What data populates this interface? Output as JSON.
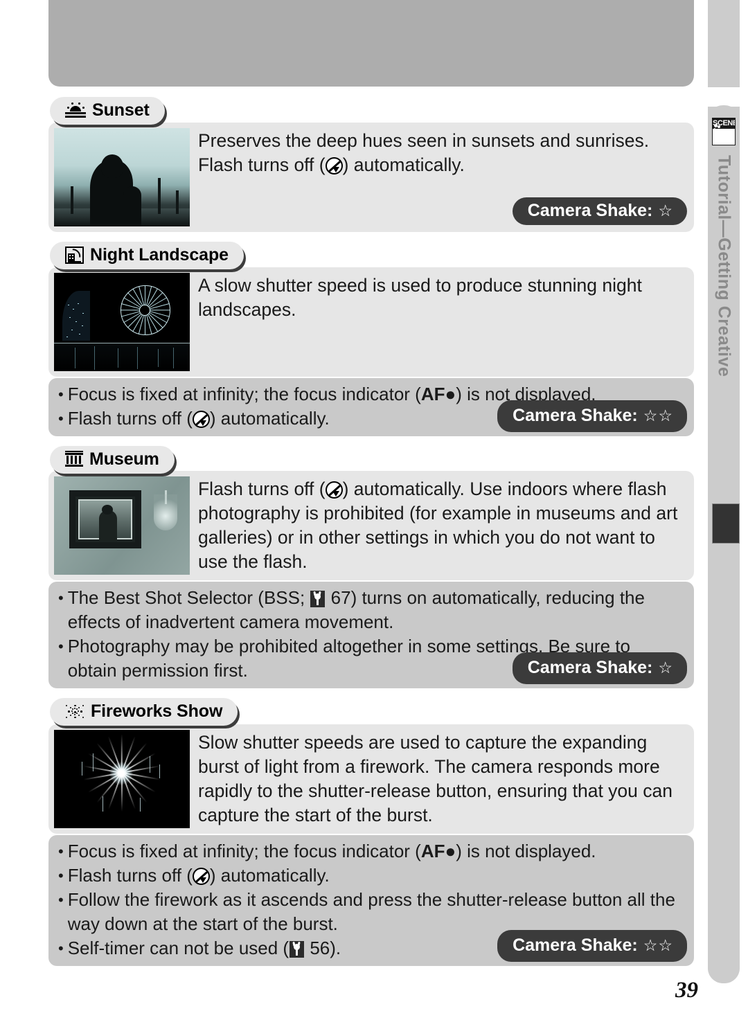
{
  "document": {
    "page_number": "39",
    "side_rail": {
      "scene_icon_label": "SCENE",
      "vertical_text": "Tutorial—Getting Creative"
    }
  },
  "sections": [
    {
      "id": "sunset",
      "icon": "sunset-icon",
      "title": "Sunset",
      "photo_alt": "sunset-silhouette-photo",
      "body_parts": [
        {
          "type": "text",
          "value": "Preserves the deep hues seen in sunsets and sunrises.  Flash turns off ("
        },
        {
          "type": "icon",
          "value": "flash-off-icon"
        },
        {
          "type": "text",
          "value": ") automatically."
        }
      ],
      "bullets": [],
      "shake_label": "Camera Shake:",
      "shake_stars": "☆"
    },
    {
      "id": "night-landscape",
      "icon": "night-landscape-icon",
      "title": "Night Landscape",
      "photo_alt": "night-cityscape-ferris-wheel-photo",
      "body_parts": [
        {
          "type": "text",
          "value": "A slow shutter speed is used to produce stunning night landscapes."
        }
      ],
      "bullets": [
        [
          {
            "type": "text",
            "value": "Focus is fixed at infinity; the focus indicator ("
          },
          {
            "type": "bold",
            "value": "AF●"
          },
          {
            "type": "text",
            "value": ") is not displayed."
          }
        ],
        [
          {
            "type": "text",
            "value": "Flash turns off ("
          },
          {
            "type": "icon",
            "value": "flash-off-icon"
          },
          {
            "type": "text",
            "value": ") automatically."
          }
        ]
      ],
      "shake_label": "Camera Shake:",
      "shake_stars": "☆☆"
    },
    {
      "id": "museum",
      "icon": "museum-icon",
      "title": "Museum",
      "photo_alt": "framed-painting-on-wall-photo",
      "body_parts": [
        {
          "type": "text",
          "value": "Flash turns off ("
        },
        {
          "type": "icon",
          "value": "flash-off-icon"
        },
        {
          "type": "text",
          "value": ") automatically.  Use indoors where flash photography is prohibited (for example in museums and art galleries) or in other settings in which you do not want to use the flash."
        }
      ],
      "bullets": [
        [
          {
            "type": "text",
            "value": "The Best Shot Selector (BSS; "
          },
          {
            "type": "icon",
            "value": "page-reference-icon"
          },
          {
            "type": "text",
            "value": " 67) turns on automatically, reducing the effects of inadvertent camera movement."
          }
        ],
        [
          {
            "type": "text",
            "value": "Photography may be prohibited altogether in some settings.  Be sure to obtain permission first."
          }
        ]
      ],
      "shake_label": "Camera Shake:",
      "shake_stars": "☆"
    },
    {
      "id": "fireworks-show",
      "icon": "fireworks-icon",
      "title": "Fireworks Show",
      "photo_alt": "fireworks-burst-photo",
      "body_parts": [
        {
          "type": "text",
          "value": "Slow shutter speeds are used to capture the expanding burst of light from a firework.  The camera responds more rapidly to the shutter-release button, ensuring that you can capture the start of the burst."
        }
      ],
      "bullets": [
        [
          {
            "type": "text",
            "value": "Focus is fixed at infinity; the focus indicator ("
          },
          {
            "type": "bold",
            "value": "AF●"
          },
          {
            "type": "text",
            "value": ") is not displayed."
          }
        ],
        [
          {
            "type": "text",
            "value": "Flash turns off ("
          },
          {
            "type": "icon",
            "value": "flash-off-icon"
          },
          {
            "type": "text",
            "value": ") automatically."
          }
        ],
        [
          {
            "type": "text",
            "value": "Follow the firework as it ascends and press the shutter-release button all the way down at the start of the burst."
          }
        ],
        [
          {
            "type": "text",
            "value": "Self-timer can not be used ("
          },
          {
            "type": "icon",
            "value": "page-reference-icon"
          },
          {
            "type": "text",
            "value": " 56)."
          }
        ]
      ],
      "shake_label": "Camera Shake:",
      "shake_stars": "☆☆"
    }
  ],
  "colors": {
    "header_band": "#adadad",
    "panel_bg": "#e6e6e6",
    "bullets_bg": "#c9c9c9",
    "badge_bg": "#3b3b3b",
    "rail_bg": "#cccccc",
    "rail_tab": "#333333"
  }
}
